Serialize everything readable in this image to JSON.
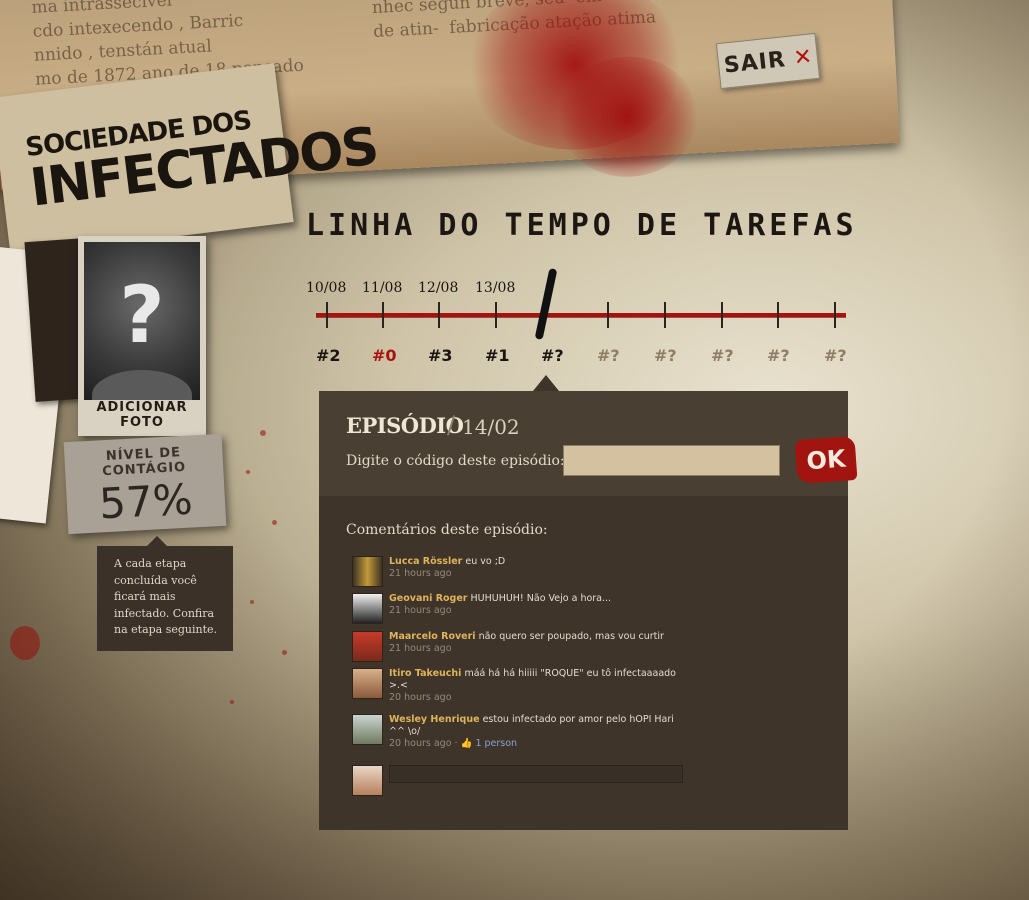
{
  "header": {
    "exit_label": "SAIR",
    "exit_icon": "close-x-icon",
    "logo_line1": "SOCIEDADE DOS",
    "logo_line2": "INFECTADOS"
  },
  "profile": {
    "add_photo_label": "ADICIONAR FOTO",
    "contact_label": "NÍVEL DE CONTÁGIO",
    "contact_value": "57%",
    "tip": "A cada etapa concluída você ficará mais infectado. Confira na etapa seguinte."
  },
  "timeline": {
    "title": "LINHA DO TEMPO DE TAREFAS",
    "dates": [
      "10/08",
      "11/08",
      "12/08",
      "13/08"
    ],
    "episodes": [
      {
        "label": "#2",
        "state": "done"
      },
      {
        "label": "#0",
        "state": "red"
      },
      {
        "label": "#3",
        "state": "done"
      },
      {
        "label": "#1",
        "state": "done"
      },
      {
        "label": "#?",
        "state": "current"
      },
      {
        "label": "#?",
        "state": "locked"
      },
      {
        "label": "#?",
        "state": "locked"
      },
      {
        "label": "#?",
        "state": "locked"
      },
      {
        "label": "#?",
        "state": "locked"
      },
      {
        "label": "#?",
        "state": "locked"
      }
    ]
  },
  "episode": {
    "title": "EPISÓDIO",
    "date": "14/02",
    "code_label": "Digite o código deste episódio:",
    "code_value": "",
    "ok_label": "OK"
  },
  "comments": {
    "title": "Comentários deste episódio:",
    "items": [
      {
        "name": "Lucca Rössler",
        "text": "eu vo ;D",
        "time": "21 hours ago",
        "likes": ""
      },
      {
        "name": "Geovani Roger",
        "text": "HUHUHUH! Não Vejo a hora...",
        "time": "21 hours ago",
        "likes": ""
      },
      {
        "name": "Maarcelo Roveri",
        "text": "não quero ser poupado, mas vou curtir",
        "time": "21 hours ago",
        "likes": ""
      },
      {
        "name": "Itiro Takeuchi",
        "text": "máá há há hiiiii \"ROQUE\" eu tô infectaaaado >.<",
        "time": "20 hours ago",
        "likes": ""
      },
      {
        "name": "Wesley Henrique",
        "text": "estou infectado por amor pelo hOPI Hari ^^ \\o/",
        "time": "20 hours ago",
        "likes": "1 person"
      }
    ],
    "reply_value": ""
  },
  "colors": {
    "blood": "#a9110e",
    "panel": "#3e342a",
    "name_accent": "#e0b45c"
  }
}
